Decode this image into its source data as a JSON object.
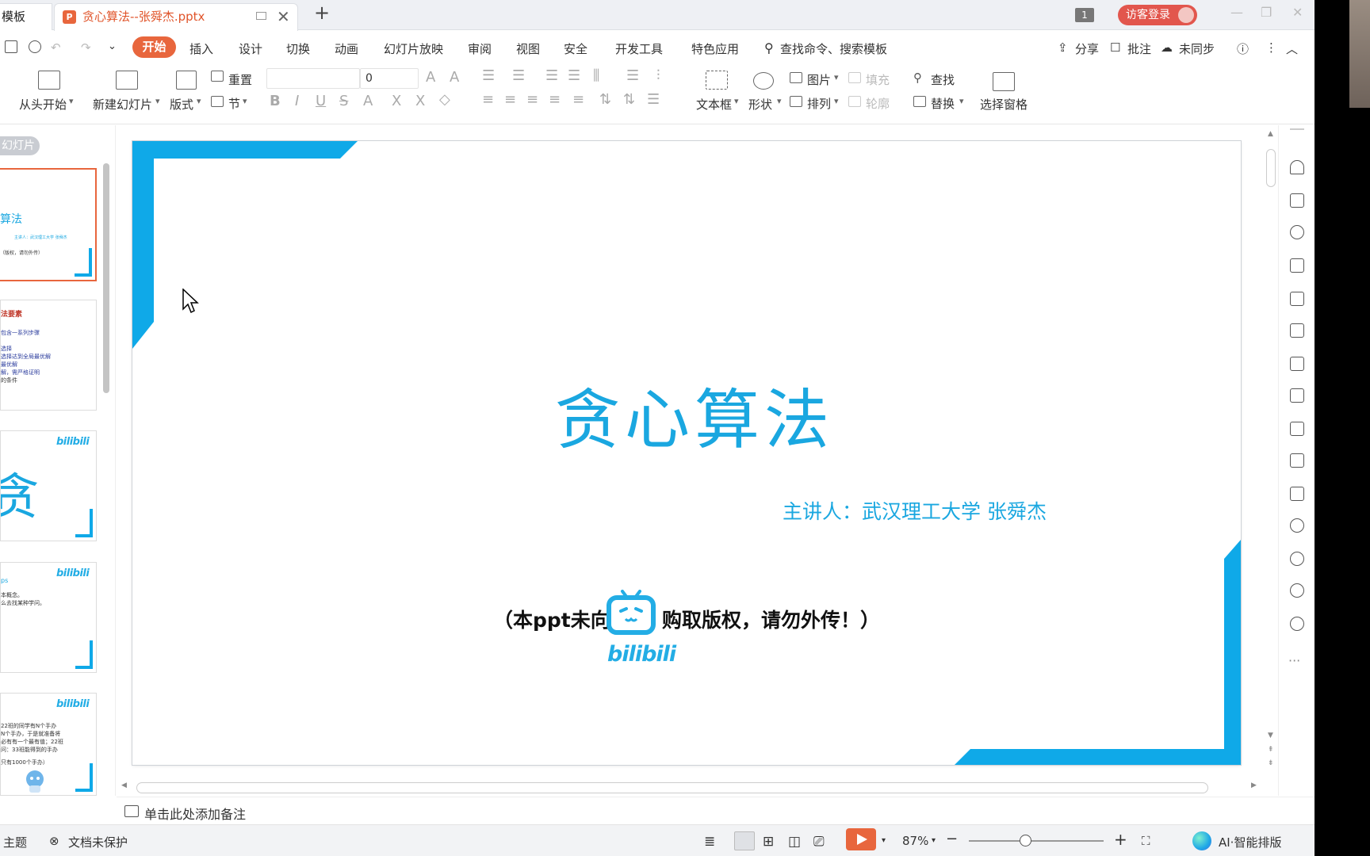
{
  "titlebar": {
    "prev_tab": "模板",
    "active_tab": "贪心算法--张舜杰.pptx",
    "page_badge": "1",
    "login": "访客登录"
  },
  "menu": {
    "start": "开始",
    "items": [
      "插入",
      "设计",
      "切换",
      "动画",
      "幻灯片放映",
      "审阅",
      "视图",
      "安全",
      "开发工具",
      "特色应用"
    ],
    "search": "查找命令、搜索模板",
    "share": "分享",
    "comment": "批注",
    "sync": "未同步"
  },
  "ribbon": {
    "from_start": "从头开始",
    "new_slide": "新建幻灯片",
    "layout": "版式",
    "reset": "重置",
    "section": "节",
    "font_size": "0",
    "textbox": "文本框",
    "shape": "形状",
    "picture": "图片",
    "fill": "填充",
    "arrange": "排列",
    "outline": "轮廓",
    "find": "查找",
    "replace": "替换",
    "select_pane": "选择窗格"
  },
  "left_panel": {
    "tab": "幻灯片",
    "thumbs": [
      {
        "title": "算法",
        "sub": "主讲人：武汉理工大学 张舜杰",
        "note": "（版权，请勿外传）"
      },
      {
        "title": "法要素",
        "lines": [
          "包含一系列步骤",
          "选择",
          "选择达到全局最优解",
          "最优解",
          "解，需严格证明",
          "的条件"
        ]
      },
      {
        "brand": "bilibili",
        "big": "贪"
      },
      {
        "brand": "bilibili",
        "title": "ps",
        "lines": [
          "本概念。",
          "么去找某种学问。"
        ]
      },
      {
        "brand": "bilibili",
        "lines": [
          "22班的同学有N个手办",
          "N个手办，于是就准备将",
          "必有有一个最有值；22班",
          "问：33班能得到的手办",
          "只有1000个手办）"
        ]
      }
    ]
  },
  "slide": {
    "title": "贪心算法",
    "speaker": "主讲人：武汉理工大学 张舜杰",
    "note_left": "（本ppt未向",
    "note_right": "购取版权，请勿外传！）",
    "bili_text": "bilibili"
  },
  "notes": {
    "placeholder": "单击此处添加备注"
  },
  "status": {
    "theme": "主题",
    "protect": "文档未保护",
    "zoom": "87%",
    "ai": "AI·智能排版"
  },
  "colors": {
    "accent": "#e8663d",
    "slide_blue": "#0fa9e8"
  }
}
